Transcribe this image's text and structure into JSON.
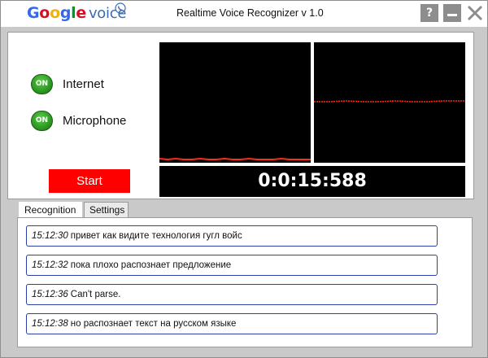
{
  "window": {
    "app_title": "Realtime Voice Recognizer v 1.0",
    "logo": {
      "google": "Google",
      "voice": "voice"
    },
    "buttons": {
      "help": "?",
      "minimize": "minimize",
      "close": "close"
    }
  },
  "status": {
    "internet": {
      "badge": "ON",
      "label": "Internet"
    },
    "microphone": {
      "badge": "ON",
      "label": "Microphone"
    }
  },
  "controls": {
    "start_label": "Start"
  },
  "timer": {
    "value": "0:0:15:588"
  },
  "tabs": [
    {
      "label": "Recognition",
      "active": true
    },
    {
      "label": "Settings",
      "active": false
    }
  ],
  "results": [
    {
      "time": "15:12:30",
      "text": "привет как видите технология гугл войс"
    },
    {
      "time": "15:12:32",
      "text": "пока плохо распознает предложение"
    },
    {
      "time": "15:12:36",
      "text": "Can't parse."
    },
    {
      "time": "15:12:38",
      "text": "но распознает текст на русском языке"
    }
  ],
  "colors": {
    "start_button": "#ff0000",
    "signal_line": "#ff2a1a",
    "on_badge": "#2f9e24",
    "item_border": "#2b3fa8",
    "scope_bg": "#000000"
  }
}
